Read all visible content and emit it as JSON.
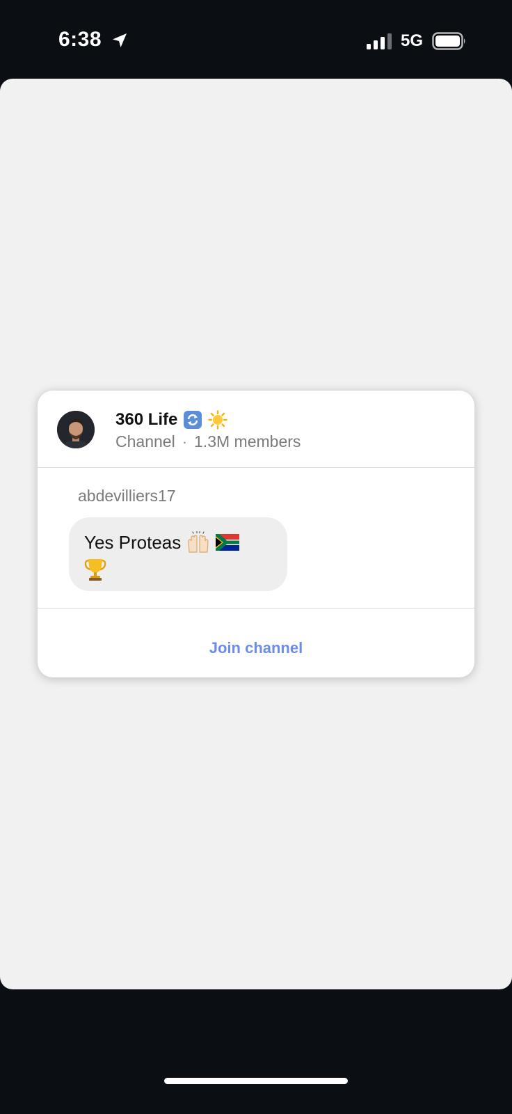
{
  "status_bar": {
    "time": "6:38",
    "network": "5G",
    "icons": [
      "location-arrow-icon",
      "cellular-signal-icon",
      "battery-icon"
    ]
  },
  "card": {
    "channel_name": "360 Life",
    "channel_emojis": [
      "arrows-counterclockwise-icon",
      "sun-icon"
    ],
    "channel_type": "Channel",
    "meta_separator": "·",
    "members": "1.3M members",
    "author": "abdevilliers17",
    "message_text": "Yes Proteas",
    "message_emojis": [
      "raising-hands-icon",
      "south-africa-flag-icon",
      "trophy-icon"
    ],
    "join_label": "Join channel"
  },
  "colors": {
    "background": "#0b0e13",
    "sheet": "#f1f1f1",
    "card": "#ffffff",
    "bubble": "#eeeeee",
    "accent": "#6b8de8"
  }
}
